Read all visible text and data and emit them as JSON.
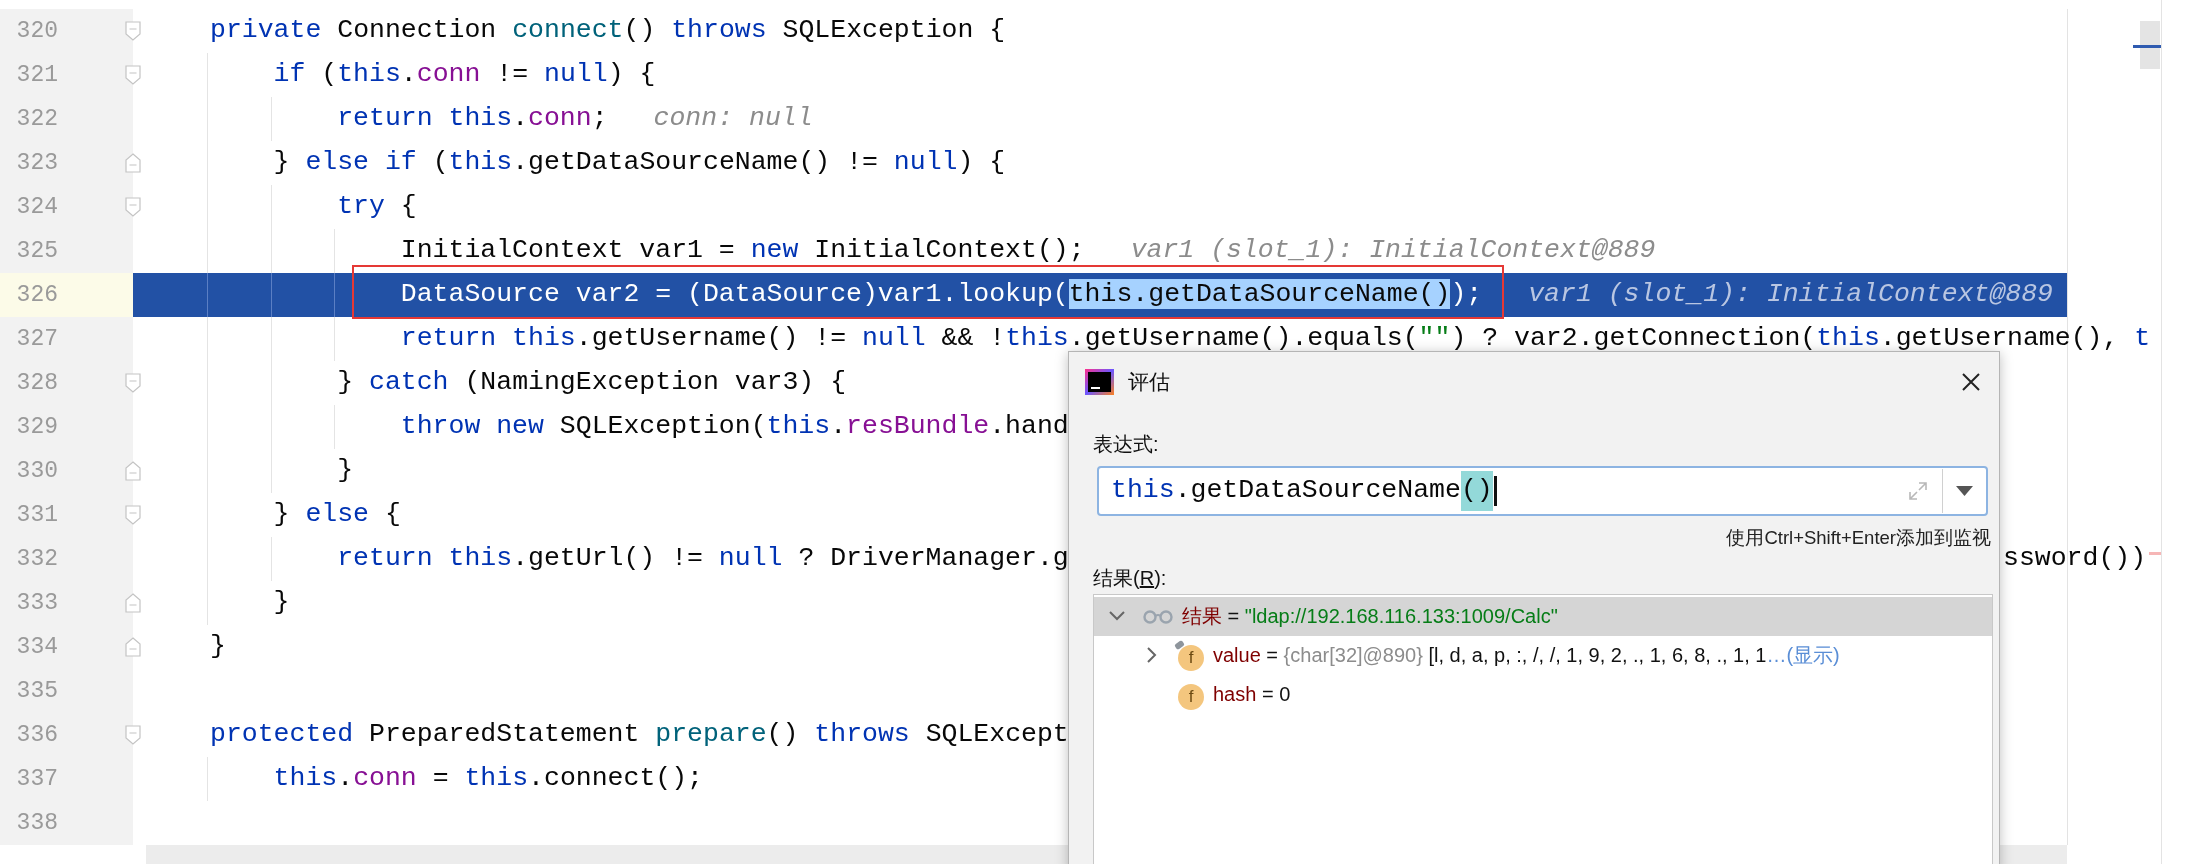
{
  "editor": {
    "lines": [
      {
        "number": "320",
        "kind": "fold_start",
        "tokens": [
          {
            "text": "    private",
            "kind": "keyword"
          },
          {
            "text": " Connection ",
            "kind": "plain"
          },
          {
            "text": "connect",
            "kind": "method"
          },
          {
            "text": "() ",
            "kind": "plain"
          },
          {
            "text": "throws",
            "kind": "keyword"
          },
          {
            "text": " SQLException {",
            "kind": "plain"
          }
        ]
      },
      {
        "number": "321",
        "kind": "fold_start",
        "tokens": [
          {
            "text": "        if",
            "kind": "keyword"
          },
          {
            "text": " (",
            "kind": "plain"
          },
          {
            "text": "this",
            "kind": "keyword"
          },
          {
            "text": ".",
            "kind": "plain"
          },
          {
            "text": "conn",
            "kind": "field"
          },
          {
            "text": " != ",
            "kind": "plain"
          },
          {
            "text": "null",
            "kind": "keyword"
          },
          {
            "text": ") {",
            "kind": "plain"
          }
        ]
      },
      {
        "number": "322",
        "tokens": [
          {
            "text": "            return this",
            "kind": "keyword"
          },
          {
            "text": ".",
            "kind": "plain"
          },
          {
            "text": "conn",
            "kind": "field"
          },
          {
            "text": ";",
            "kind": "plain"
          }
        ],
        "hint": "conn: null"
      },
      {
        "number": "323",
        "kind": "fold_end",
        "tokens": [
          {
            "text": "        } ",
            "kind": "plain"
          },
          {
            "text": "else if",
            "kind": "keyword"
          },
          {
            "text": " (",
            "kind": "plain"
          },
          {
            "text": "this",
            "kind": "keyword"
          },
          {
            "text": ".getDataSourceName() != ",
            "kind": "plain"
          },
          {
            "text": "null",
            "kind": "keyword"
          },
          {
            "text": ") {",
            "kind": "plain"
          }
        ]
      },
      {
        "number": "324",
        "kind": "fold_start",
        "tokens": [
          {
            "text": "            try",
            "kind": "keyword"
          },
          {
            "text": " {",
            "kind": "plain"
          }
        ]
      },
      {
        "number": "325",
        "tokens": [
          {
            "text": "                InitialContext var1 = ",
            "kind": "plain"
          },
          {
            "text": "new",
            "kind": "keyword"
          },
          {
            "text": " InitialContext();",
            "kind": "plain"
          }
        ],
        "hint": "var1 (slot_1): InitialContext@889"
      },
      {
        "number": "326",
        "current": true,
        "tokens": [
          {
            "text": "                DataSource var2 = (DataSource)var1.lookup(",
            "kind": "plain"
          },
          {
            "text": "this.getDataSourceName()",
            "kind": "selection"
          },
          {
            "text": ");",
            "kind": "plain"
          }
        ],
        "hint": "var1 (slot_1): InitialContext@889"
      },
      {
        "number": "327",
        "tokens": [
          {
            "text": "                return this",
            "kind": "keyword"
          },
          {
            "text": ".getUsername() != ",
            "kind": "plain"
          },
          {
            "text": "null",
            "kind": "keyword"
          },
          {
            "text": " && !",
            "kind": "plain"
          },
          {
            "text": "this",
            "kind": "keyword"
          },
          {
            "text": ".getUsername().equals(",
            "kind": "plain"
          },
          {
            "text": "\"\"",
            "kind": "string"
          },
          {
            "text": ") ? var2.getConnection(",
            "kind": "plain"
          },
          {
            "text": "this",
            "kind": "keyword"
          },
          {
            "text": ".getUsername(), ",
            "kind": "plain"
          },
          {
            "text": "t",
            "kind": "keyword"
          }
        ]
      },
      {
        "number": "328",
        "kind": "fold_start",
        "tokens": [
          {
            "text": "            } ",
            "kind": "plain"
          },
          {
            "text": "catch",
            "kind": "keyword"
          },
          {
            "text": " (NamingException var3) {",
            "kind": "plain"
          }
        ]
      },
      {
        "number": "329",
        "tokens": [
          {
            "text": "                throw new",
            "kind": "keyword"
          },
          {
            "text": " SQLException(",
            "kind": "plain"
          },
          {
            "text": "this",
            "kind": "keyword"
          },
          {
            "text": ".",
            "kind": "plain"
          },
          {
            "text": "resBundle",
            "kind": "field"
          },
          {
            "text": ".hand",
            "kind": "plain"
          }
        ]
      },
      {
        "number": "330",
        "kind": "fold_end",
        "tokens": [
          {
            "text": "            }",
            "kind": "plain"
          }
        ]
      },
      {
        "number": "331",
        "kind": "fold_start",
        "tokens": [
          {
            "text": "        } ",
            "kind": "plain"
          },
          {
            "text": "else",
            "kind": "keyword"
          },
          {
            "text": " {",
            "kind": "plain"
          }
        ]
      },
      {
        "number": "332",
        "tokens": [
          {
            "text": "            return this",
            "kind": "keyword"
          },
          {
            "text": ".getUrl() != ",
            "kind": "plain"
          },
          {
            "text": "null",
            "kind": "keyword"
          },
          {
            "text": " ? DriverManager.g",
            "kind": "plain"
          }
        ],
        "right_text": "ssword())"
      },
      {
        "number": "333",
        "kind": "fold_end",
        "tokens": [
          {
            "text": "        }",
            "kind": "plain"
          }
        ]
      },
      {
        "number": "334",
        "kind": "fold_end",
        "tokens": [
          {
            "text": "    }",
            "kind": "plain"
          }
        ]
      },
      {
        "number": "335"
      },
      {
        "number": "336",
        "kind": "fold_start",
        "tokens": [
          {
            "text": "    protected",
            "kind": "keyword"
          },
          {
            "text": " PreparedStatement ",
            "kind": "plain"
          },
          {
            "text": "prepare",
            "kind": "method"
          },
          {
            "text": "() ",
            "kind": "plain"
          },
          {
            "text": "throws",
            "kind": "keyword"
          },
          {
            "text": " SQLExcept",
            "kind": "plain"
          }
        ]
      },
      {
        "number": "337",
        "tokens": [
          {
            "text": "        this",
            "kind": "keyword"
          },
          {
            "text": ".",
            "kind": "plain"
          },
          {
            "text": "conn",
            "kind": "field"
          },
          {
            "text": " = ",
            "kind": "plain"
          },
          {
            "text": "this",
            "kind": "keyword"
          },
          {
            "text": ".connect();",
            "kind": "plain"
          }
        ]
      },
      {
        "number": "338"
      }
    ]
  },
  "evaluate_dialog": {
    "title": "评估",
    "expression_label": "表达式:",
    "expression": [
      {
        "text": "this",
        "kind": "keyword"
      },
      {
        "text": ".getDataSourceName",
        "kind": "plain"
      },
      {
        "text": "()",
        "kind": "brace_match"
      }
    ],
    "hint": "使用Ctrl+Shift+Enter添加到监视",
    "result_label": [
      {
        "text": "结果(",
        "underlined": false
      },
      {
        "text": "R",
        "underlined": true
      },
      {
        "text": "):",
        "underlined": false
      }
    ],
    "results": [
      {
        "name": "结果",
        "kind": "watch",
        "operator": "=",
        "value": {
          "text": "\"ldap://192.168.116.133:1009/Calc\"",
          "kind": "string"
        },
        "expanded": true,
        "selected": true,
        "children": [
          {
            "name": "value",
            "kind": "field_tagged",
            "badge": "f",
            "operator": "=",
            "type_info": "{char[32]@890}",
            "value": {
              "text": "[l, d, a, p, :, /, /, 1, 9, 2, ., 1, 6, 8, ., 1, 1",
              "kind": "plain"
            },
            "link": "…(显示)",
            "expanded": false,
            "selected": false
          },
          {
            "name": "hash",
            "kind": "field",
            "badge": "f",
            "operator": "=",
            "value": {
              "text": "0",
              "kind": "plain"
            },
            "selected": false
          }
        ]
      }
    ]
  }
}
